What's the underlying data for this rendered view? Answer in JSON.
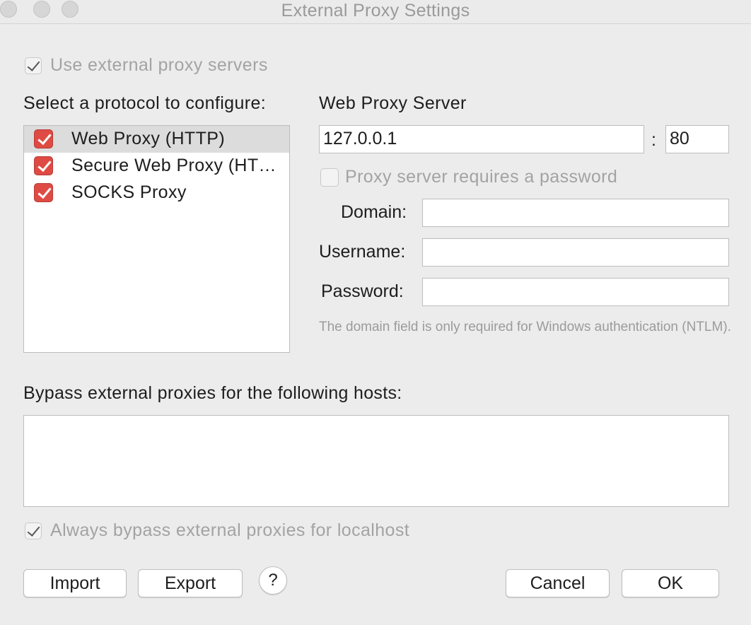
{
  "window": {
    "title": "External Proxy Settings"
  },
  "use_external": {
    "label": "Use external proxy servers",
    "checked": true
  },
  "protocols": {
    "heading": "Select a protocol to configure:",
    "items": [
      {
        "label": "Web Proxy (HTTP)",
        "checked": true,
        "selected": true
      },
      {
        "label": "Secure Web Proxy (HT…",
        "checked": true,
        "selected": false
      },
      {
        "label": "SOCKS Proxy",
        "checked": true,
        "selected": false
      }
    ]
  },
  "server": {
    "heading": "Web Proxy Server",
    "host": "127.0.0.1",
    "separator": ":",
    "port": "80",
    "requires_password_label": "Proxy server requires a password",
    "requires_password_checked": false,
    "domain_label": "Domain:",
    "domain_value": "",
    "username_label": "Username:",
    "username_value": "",
    "password_label": "Password:",
    "password_value": "",
    "note": "The domain field is only required for Windows authentication (NTLM)."
  },
  "bypass": {
    "heading": "Bypass external proxies for the following hosts:",
    "hosts_value": "",
    "localhost_label": "Always bypass external proxies for localhost",
    "localhost_checked": true
  },
  "buttons": {
    "import": "Import",
    "export": "Export",
    "help": "?",
    "cancel": "Cancel",
    "ok": "OK"
  }
}
